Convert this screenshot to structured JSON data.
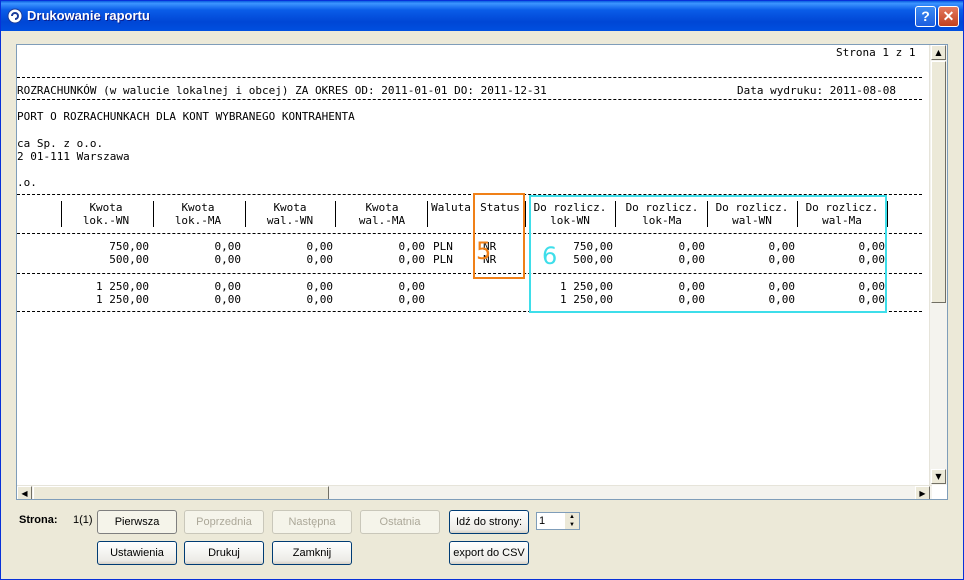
{
  "window": {
    "title": "Drukowanie raportu",
    "help_btn": "?",
    "close_btn": "✕"
  },
  "report": {
    "page_label": "Strona 1 z 1",
    "header_line": "ROZRACHUNKÓW (w walucie lokalnej i obcej) ZA OKRES OD: 2011-01-01 DO: 2011-12-31",
    "print_date": "Data wydruku: 2011-08-08",
    "subtitle": "PORT O ROZRACHUNKACH DLA KONT WYBRANEGO KONTRAHENTA",
    "company_line1": "ca Sp. z o.o.",
    "company_line2": "2 01-111 Warszawa",
    "other_line": ".o.",
    "columns": [
      {
        "l1": "Kwota",
        "l2": "lok.-WN"
      },
      {
        "l1": "Kwota",
        "l2": "lok.-MA"
      },
      {
        "l1": "Kwota",
        "l2": "wal.-WN"
      },
      {
        "l1": "Kwota",
        "l2": "wal.-MA"
      },
      {
        "l1": "Waluta",
        "l2": ""
      },
      {
        "l1": "Status",
        "l2": ""
      },
      {
        "l1": "Do rozlicz.",
        "l2": "lok-WN"
      },
      {
        "l1": "Do rozlicz.",
        "l2": "lok-Ma"
      },
      {
        "l1": "Do rozlicz.",
        "l2": "wal-WN"
      },
      {
        "l1": "Do rozlicz.",
        "l2": "wal-Ma"
      }
    ],
    "rows": [
      [
        "750,00",
        "0,00",
        "0,00",
        "0,00",
        "PLN",
        "NR",
        "750,00",
        "0,00",
        "0,00",
        "0,00"
      ],
      [
        "500,00",
        "0,00",
        "0,00",
        "0,00",
        "PLN",
        "NR",
        "500,00",
        "0,00",
        "0,00",
        "0,00"
      ]
    ],
    "totals": [
      [
        "1 250,00",
        "0,00",
        "0,00",
        "0,00",
        "",
        "",
        "1 250,00",
        "0,00",
        "0,00",
        "0,00"
      ],
      [
        "1 250,00",
        "0,00",
        "0,00",
        "0,00",
        "",
        "",
        "1 250,00",
        "0,00",
        "0,00",
        "0,00"
      ]
    ]
  },
  "annotations": {
    "status_label": "5",
    "settle_label": "6",
    "status_color": "#F08018",
    "settle_color": "#3EDEEA"
  },
  "footer": {
    "page_label": "Strona:",
    "page_info": "1(1)",
    "first": "Pierwsza",
    "prev": "Poprzednia",
    "next": "Następna",
    "last": "Ostatnia",
    "goto": "Idź do strony:",
    "goto_value": "1",
    "settings": "Ustawienia",
    "print": "Drukuj",
    "close": "Zamknij",
    "export": "export do CSV"
  }
}
